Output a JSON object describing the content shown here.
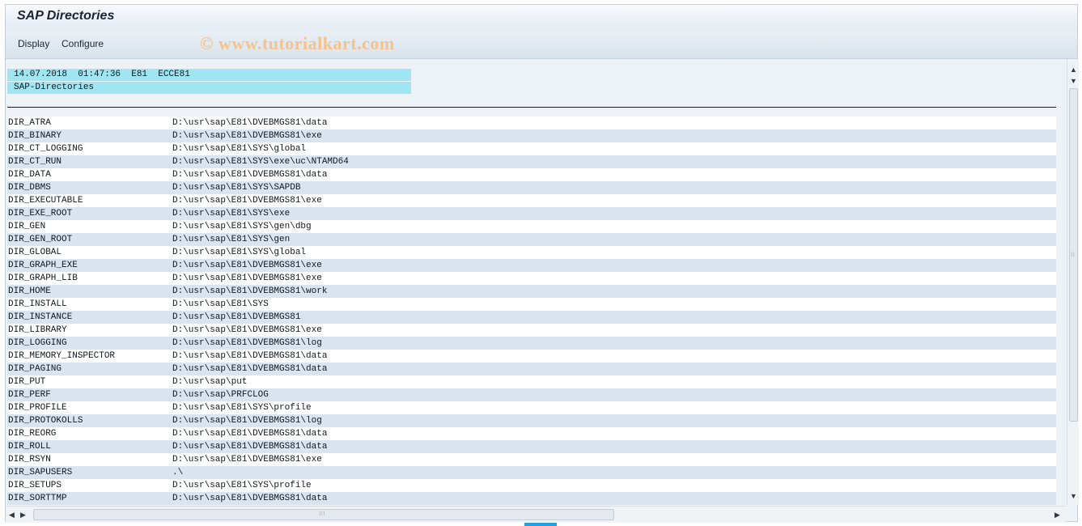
{
  "window": {
    "title": "SAP Directories"
  },
  "menu": {
    "display": "Display",
    "configure": "Configure"
  },
  "watermark": "© www.tutorialkart.com",
  "report_header": {
    "line1": "14.07.2018  01:47:36  E81  ECCE81",
    "line2": "SAP-Directories"
  },
  "rows": [
    {
      "name": "DIR_ATRA",
      "path": "D:\\usr\\sap\\E81\\DVEBMGS81\\data"
    },
    {
      "name": "DIR_BINARY",
      "path": "D:\\usr\\sap\\E81\\DVEBMGS81\\exe"
    },
    {
      "name": "DIR_CT_LOGGING",
      "path": "D:\\usr\\sap\\E81\\SYS\\global"
    },
    {
      "name": "DIR_CT_RUN",
      "path": "D:\\usr\\sap\\E81\\SYS\\exe\\uc\\NTAMD64"
    },
    {
      "name": "DIR_DATA",
      "path": "D:\\usr\\sap\\E81\\DVEBMGS81\\data"
    },
    {
      "name": "DIR_DBMS",
      "path": "D:\\usr\\sap\\E81\\SYS\\SAPDB"
    },
    {
      "name": "DIR_EXECUTABLE",
      "path": "D:\\usr\\sap\\E81\\DVEBMGS81\\exe"
    },
    {
      "name": "DIR_EXE_ROOT",
      "path": "D:\\usr\\sap\\E81\\SYS\\exe"
    },
    {
      "name": "DIR_GEN",
      "path": "D:\\usr\\sap\\E81\\SYS\\gen\\dbg"
    },
    {
      "name": "DIR_GEN_ROOT",
      "path": "D:\\usr\\sap\\E81\\SYS\\gen"
    },
    {
      "name": "DIR_GLOBAL",
      "path": "D:\\usr\\sap\\E81\\SYS\\global"
    },
    {
      "name": "DIR_GRAPH_EXE",
      "path": "D:\\usr\\sap\\E81\\DVEBMGS81\\exe"
    },
    {
      "name": "DIR_GRAPH_LIB",
      "path": "D:\\usr\\sap\\E81\\DVEBMGS81\\exe"
    },
    {
      "name": "DIR_HOME",
      "path": "D:\\usr\\sap\\E81\\DVEBMGS81\\work"
    },
    {
      "name": "DIR_INSTALL",
      "path": "D:\\usr\\sap\\E81\\SYS"
    },
    {
      "name": "DIR_INSTANCE",
      "path": "D:\\usr\\sap\\E81\\DVEBMGS81"
    },
    {
      "name": "DIR_LIBRARY",
      "path": "D:\\usr\\sap\\E81\\DVEBMGS81\\exe"
    },
    {
      "name": "DIR_LOGGING",
      "path": "D:\\usr\\sap\\E81\\DVEBMGS81\\log"
    },
    {
      "name": "DIR_MEMORY_INSPECTOR",
      "path": "D:\\usr\\sap\\E81\\DVEBMGS81\\data"
    },
    {
      "name": "DIR_PAGING",
      "path": "D:\\usr\\sap\\E81\\DVEBMGS81\\data"
    },
    {
      "name": "DIR_PUT",
      "path": "D:\\usr\\sap\\put"
    },
    {
      "name": "DIR_PERF",
      "path": "D:\\usr\\sap\\PRFCLOG"
    },
    {
      "name": "DIR_PROFILE",
      "path": "D:\\usr\\sap\\E81\\SYS\\profile"
    },
    {
      "name": "DIR_PROTOKOLLS",
      "path": "D:\\usr\\sap\\E81\\DVEBMGS81\\log"
    },
    {
      "name": "DIR_REORG",
      "path": "D:\\usr\\sap\\E81\\DVEBMGS81\\data"
    },
    {
      "name": "DIR_ROLL",
      "path": "D:\\usr\\sap\\E81\\DVEBMGS81\\data"
    },
    {
      "name": "DIR_RSYN",
      "path": "D:\\usr\\sap\\E81\\DVEBMGS81\\exe"
    },
    {
      "name": "DIR_SAPUSERS",
      "path": ".\\"
    },
    {
      "name": "DIR_SETUPS",
      "path": "D:\\usr\\sap\\E81\\SYS\\profile"
    },
    {
      "name": "DIR_SORTTMP",
      "path": "D:\\usr\\sap\\E81\\DVEBMGS81\\data"
    }
  ],
  "icons": {
    "scroll_up": "triangle-up-icon",
    "scroll_down": "triangle-down-icon",
    "scroll_left": "triangle-left-icon",
    "scroll_right": "triangle-right-icon"
  },
  "colors": {
    "header_highlight": "#9fe6f2",
    "row_alt": "#dae3ee",
    "accent": "#1fa1dc"
  }
}
